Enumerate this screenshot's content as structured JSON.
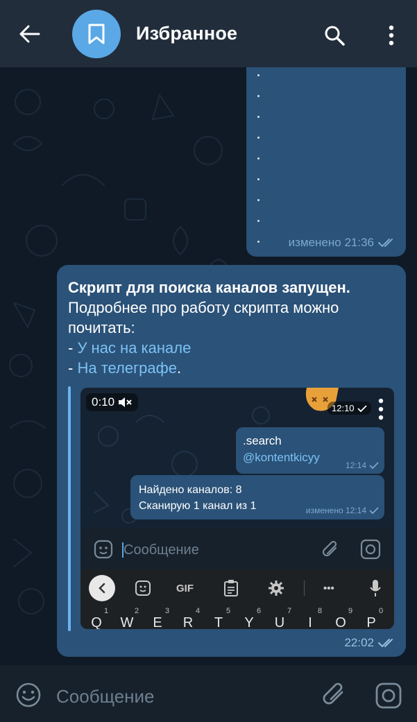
{
  "header": {
    "title": "Избранное",
    "back_icon": "arrow-left-icon",
    "avatar_icon": "bookmark-icon",
    "search_icon": "search-icon",
    "menu_icon": "more-vertical-icon"
  },
  "colors": {
    "header_bg": "#212d3b",
    "chat_bg": "#0f1a26",
    "bubble_out": "#2b5278",
    "link": "#7cc2f5",
    "avatar": "#5aa8e6"
  },
  "prev_message": {
    "meta": "изменено 21:36"
  },
  "message": {
    "bold_line": "Скрипт для поиска каналов запущен.",
    "line2": "Подробнее про работу скрипта можно",
    "line3": "почитать:",
    "bullet1_prefix": "- ",
    "bullet1_link": "У нас на канале",
    "bullet2_prefix": "- ",
    "bullet2_link": "На телеграфе",
    "bullet2_suffix": ".",
    "time": "22:02"
  },
  "video": {
    "duration": "0:10",
    "mute_icon": "muted-speaker-icon",
    "time": "12:10",
    "out_msg_line1": ".search",
    "out_msg_line2": "@kontentkicyy",
    "out_msg_time": "12:14",
    "in_msg_line1": "Найдено каналов: 8",
    "in_msg_line2": "Сканирую 1 канал из 1",
    "in_msg_meta": "изменено 12:14",
    "input_placeholder": "Сообщение",
    "keyboard": {
      "gif_label": "GIF",
      "more_label": "•••",
      "keys": [
        "Q",
        "W",
        "E",
        "R",
        "T",
        "Y",
        "U",
        "I",
        "O",
        "P"
      ],
      "numbers": [
        "1",
        "2",
        "3",
        "4",
        "5",
        "6",
        "7",
        "8",
        "9",
        "0"
      ]
    }
  },
  "input": {
    "placeholder": "Сообщение",
    "emoji_icon": "smile-icon",
    "attach_icon": "paperclip-icon",
    "camera_icon": "camera-icon"
  }
}
